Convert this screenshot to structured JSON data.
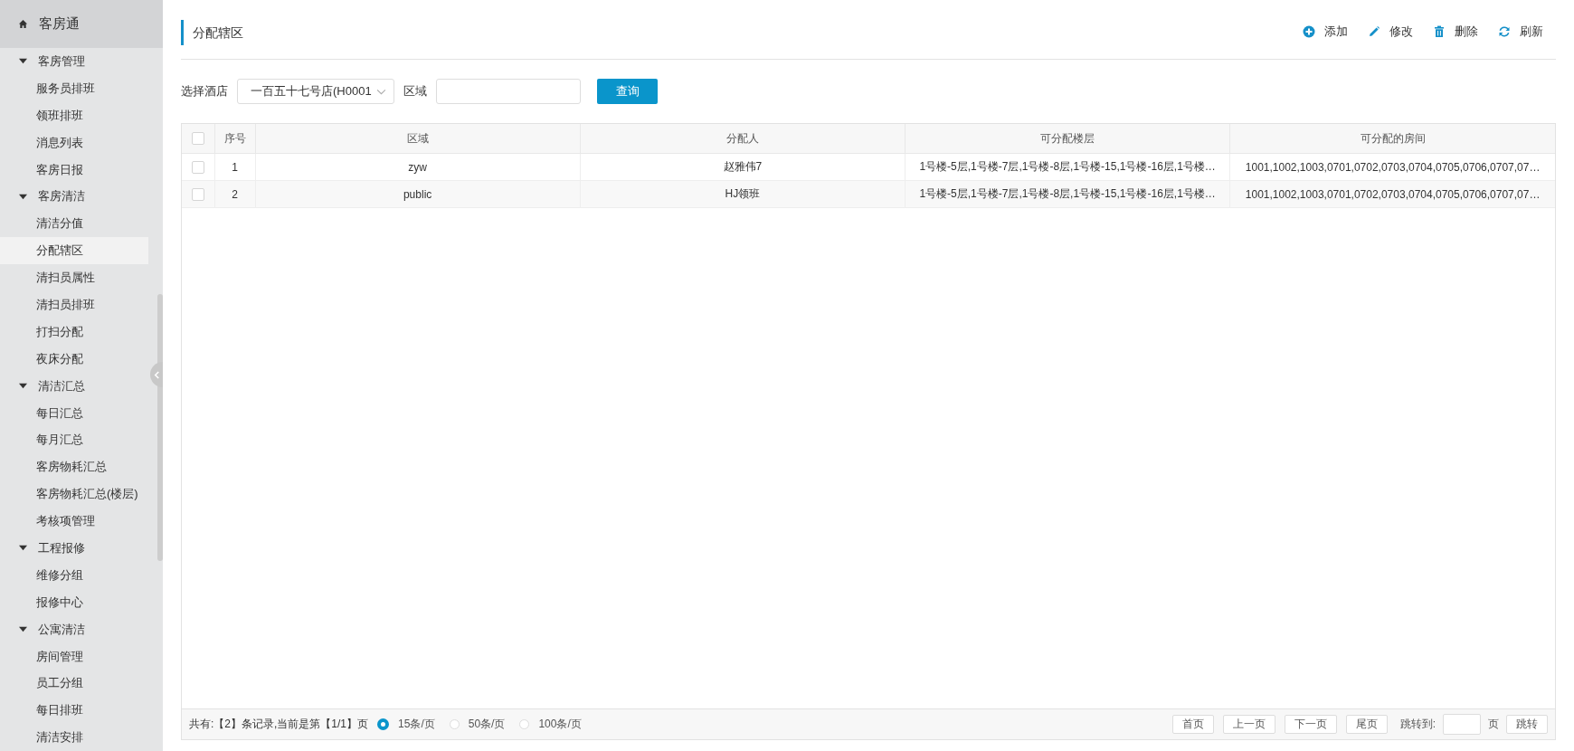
{
  "app": {
    "title": "客房通"
  },
  "sidebar": {
    "groups": [
      {
        "label": "客房管理",
        "expanded": true,
        "items": [
          {
            "label": "服务员排班",
            "selected": false
          },
          {
            "label": "领班排班",
            "selected": false
          },
          {
            "label": "消息列表",
            "selected": false
          },
          {
            "label": "客房日报",
            "selected": false
          }
        ]
      },
      {
        "label": "客房清洁",
        "expanded": true,
        "items": [
          {
            "label": "清洁分值",
            "selected": false
          },
          {
            "label": "分配辖区",
            "selected": true
          },
          {
            "label": "清扫员属性",
            "selected": false
          },
          {
            "label": "清扫员排班",
            "selected": false
          },
          {
            "label": "打扫分配",
            "selected": false
          },
          {
            "label": "夜床分配",
            "selected": false
          }
        ]
      },
      {
        "label": "清洁汇总",
        "expanded": true,
        "items": [
          {
            "label": "每日汇总",
            "selected": false
          },
          {
            "label": "每月汇总",
            "selected": false
          },
          {
            "label": "客房物耗汇总",
            "selected": false
          },
          {
            "label": "客房物耗汇总(楼层)",
            "selected": false
          },
          {
            "label": "考核项管理",
            "selected": false
          }
        ]
      },
      {
        "label": "工程报修",
        "expanded": true,
        "items": [
          {
            "label": "维修分组",
            "selected": false
          },
          {
            "label": "报修中心",
            "selected": false
          }
        ]
      },
      {
        "label": "公寓清洁",
        "expanded": true,
        "items": [
          {
            "label": "房间管理",
            "selected": false
          },
          {
            "label": "员工分组",
            "selected": false
          },
          {
            "label": "每日排班",
            "selected": false
          },
          {
            "label": "清洁安排",
            "selected": false
          }
        ]
      }
    ]
  },
  "page": {
    "title": "分配辖区"
  },
  "toolbar": [
    {
      "kind": "add",
      "label": "添加"
    },
    {
      "kind": "edit",
      "label": "修改"
    },
    {
      "kind": "delete",
      "label": "删除"
    },
    {
      "kind": "refresh",
      "label": "刷新"
    }
  ],
  "filters": {
    "hotel_label": "选择酒店",
    "hotel_value": "一百五十七号店(H0001",
    "area_label": "区域",
    "query_button": "查询"
  },
  "table": {
    "header_checked": false,
    "columns": [
      "序号",
      "区域",
      "分配人",
      "可分配楼层",
      "可分配的房间"
    ],
    "rows": [
      {
        "checked": false,
        "cells": [
          "1",
          "zyw",
          "赵雅伟7",
          "1号楼-5层,1号楼-7层,1号楼-8层,1号楼-15,1号楼-16层,1号楼…",
          "1001,1002,1003,0701,0702,0703,0704,0705,0706,0707,07…"
        ]
      },
      {
        "checked": false,
        "cells": [
          "2",
          "public",
          "HJ领班",
          "1号楼-5层,1号楼-7层,1号楼-8层,1号楼-15,1号楼-16层,1号楼…",
          "1001,1002,1003,0701,0702,0703,0704,0705,0706,0707,07…"
        ]
      }
    ]
  },
  "footer": {
    "summary": "共有:【2】条记录,当前是第【1/1】页",
    "page_sizes": [
      {
        "label": "15条/页",
        "selected": true
      },
      {
        "label": "50条/页",
        "selected": false
      },
      {
        "label": "100条/页",
        "selected": false
      }
    ],
    "buttons": [
      "首页",
      "上一页",
      "下一页",
      "尾页"
    ],
    "jump_label": "跳转到:",
    "page_unit": "页",
    "jump_button": "跳转"
  }
}
